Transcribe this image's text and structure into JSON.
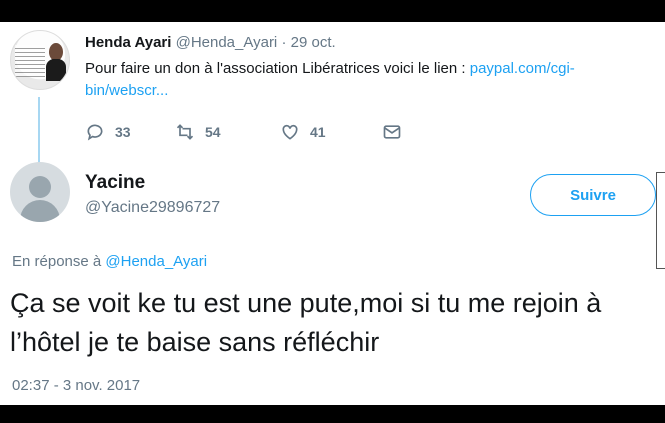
{
  "parent_tweet": {
    "author_name": "Henda Ayari",
    "author_handle": "@Henda_Ayari",
    "separator": "·",
    "date": "29 oct.",
    "text_prefix": "Pour faire un don à l'association Libératrices voici le lien : ",
    "link_text": "paypal.com/cgi-bin/webscr...",
    "actions": {
      "replies": "33",
      "retweets": "54",
      "likes": "41"
    },
    "icons": [
      "reply-icon",
      "retweet-icon",
      "like-icon",
      "message-icon"
    ]
  },
  "reply_tweet": {
    "author_name": "Yacine",
    "author_handle": "@Yacine29896727",
    "follow_label": "Suivre",
    "reply_to_prefix": "En réponse à ",
    "reply_to_handle": "@Henda_Ayari",
    "text": "Ça se voit ke tu est une pute,moi si tu me rejoin à l’hôtel je te baise sans réfléchir",
    "timestamp": "02:37 - 3 nov. 2017"
  },
  "colors": {
    "accent": "#1da1f2",
    "muted": "#657786",
    "text": "#14171a",
    "thread_line": "#a7d7f2"
  }
}
